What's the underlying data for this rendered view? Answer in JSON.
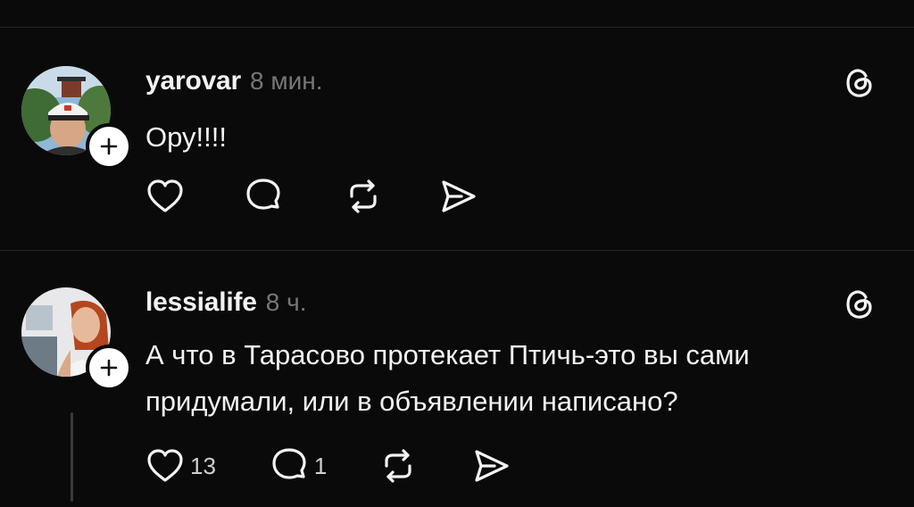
{
  "colors": {
    "background": "#0a0a0a",
    "text": "#f3f3f3",
    "muted": "#777777",
    "divider": "#262626"
  },
  "posts": [
    {
      "username": "yarovar",
      "time": "8 мин.",
      "text": "Ору!!!!",
      "likes": "",
      "replies": ""
    },
    {
      "username": "lessialife",
      "time": "8 ч.",
      "text": "А что в Тарасово протекает Птичь-это вы сами придумали, или в объявлении написано?",
      "likes": "13",
      "replies": "1"
    }
  ],
  "icons": [
    "threads-icon",
    "heart-icon",
    "comment-icon",
    "repost-icon",
    "share-icon",
    "plus-icon"
  ]
}
